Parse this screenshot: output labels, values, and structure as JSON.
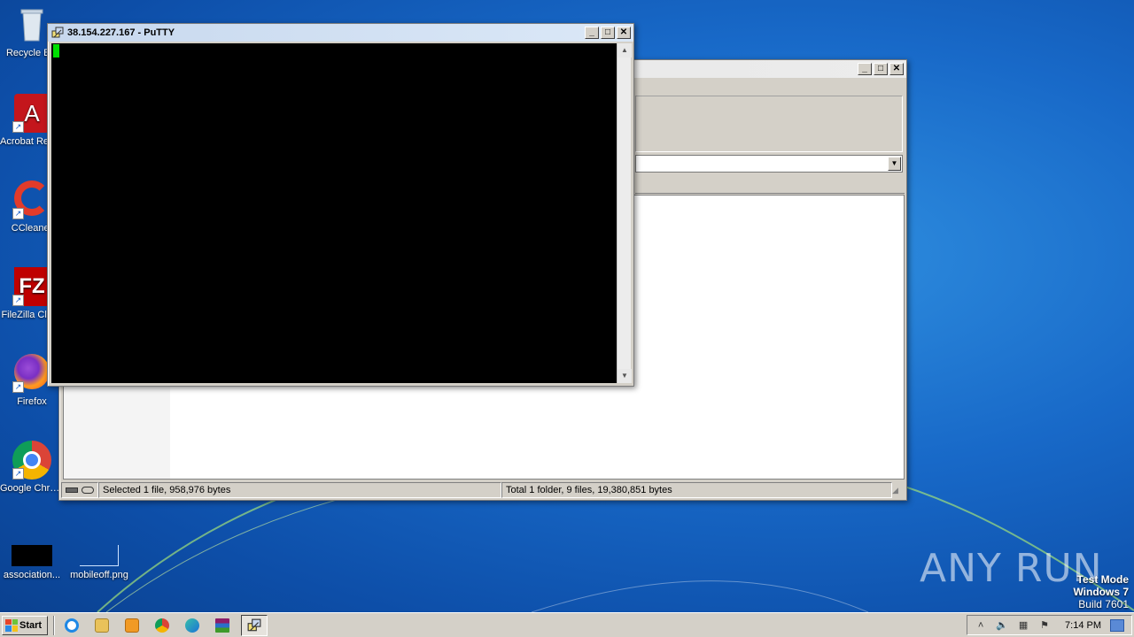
{
  "desktop": {
    "icons": [
      {
        "label": "Recycle Bin"
      },
      {
        "label": "Acrobat Reader DC"
      },
      {
        "label": "CCleaner"
      },
      {
        "label": "FileZilla Client"
      },
      {
        "label": "Firefox"
      },
      {
        "label": "Google Chrome"
      },
      {
        "label": "association..."
      },
      {
        "label": "mobileoff.png"
      }
    ]
  },
  "putty": {
    "title": "38.154.227.167 - PuTTY"
  },
  "explorer": {
    "status_selected": "Selected 1 file, 958,976 bytes",
    "status_total": "Total 1 folder, 9 files, 19,380,851 bytes"
  },
  "watermark": {
    "brand": "ANY RUN",
    "line1": "Test Mode",
    "line2": "Windows 7",
    "line3": "Build 7601"
  },
  "taskbar": {
    "start_label": "Start",
    "clock": "7:14 PM"
  },
  "colors": {
    "terminal_bg": "#000000",
    "cursor": "#00e000",
    "desktop": "#1869c8"
  }
}
